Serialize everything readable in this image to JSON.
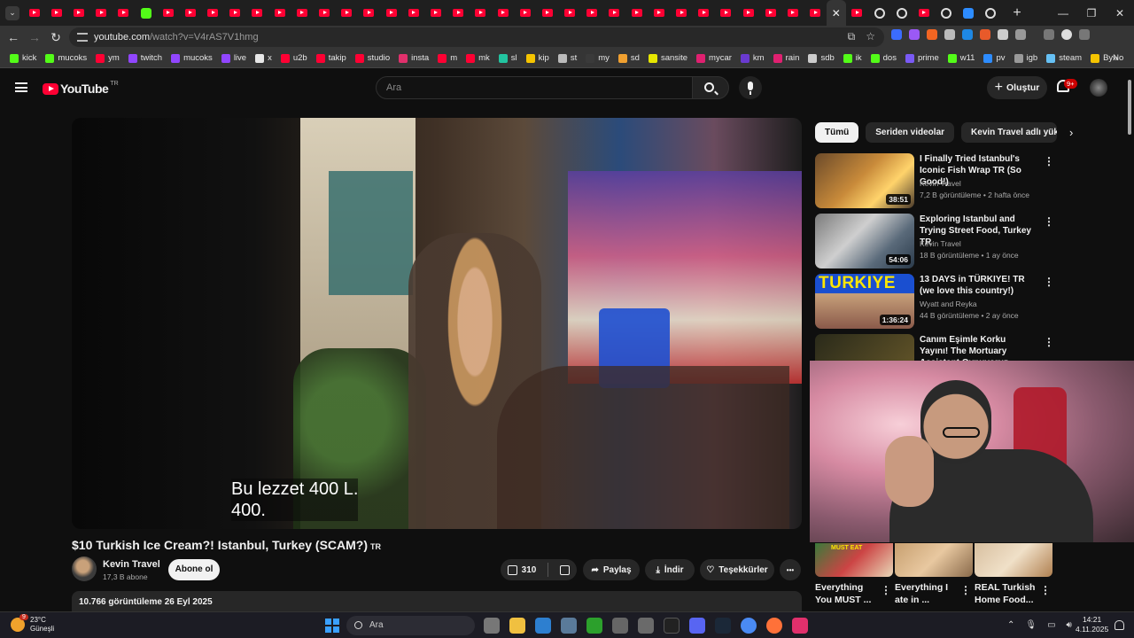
{
  "browser": {
    "url_host": "youtube.com",
    "url_path": "/watch?v=V4rAS7V1hmg",
    "active_tab_close": "✕",
    "new_tab": "+"
  },
  "bookmarks": [
    {
      "label": "kick",
      "color": "#53fc18"
    },
    {
      "label": "mucoks",
      "color": "#53fc18"
    },
    {
      "label": "ym",
      "color": "#ff0033"
    },
    {
      "label": "twitch",
      "color": "#9146ff"
    },
    {
      "label": "mucoks",
      "color": "#9146ff"
    },
    {
      "label": "live",
      "color": "#9146ff"
    },
    {
      "label": "x",
      "color": "#e7e7e7"
    },
    {
      "label": "u2b",
      "color": "#ff0033"
    },
    {
      "label": "takip",
      "color": "#ff0033"
    },
    {
      "label": "studio",
      "color": "#ff0033"
    },
    {
      "label": "insta",
      "color": "#e1306c"
    },
    {
      "label": "m",
      "color": "#ff0033"
    },
    {
      "label": "mk",
      "color": "#ff0033"
    },
    {
      "label": "sl",
      "color": "#22c4a0"
    },
    {
      "label": "kip",
      "color": "#f5c400"
    },
    {
      "label": "st",
      "color": "#bbbbbb"
    },
    {
      "label": "my",
      "color": "#3a3a3a"
    },
    {
      "label": "sd",
      "color": "#f0a030"
    },
    {
      "label": "sansite",
      "color": "#e6e600"
    },
    {
      "label": "mycar",
      "color": "#e02070"
    },
    {
      "label": "km",
      "color": "#6a3ad0"
    },
    {
      "label": "rain",
      "color": "#e02070"
    },
    {
      "label": "sdb",
      "color": "#cccccc"
    },
    {
      "label": "ik",
      "color": "#53fc18"
    },
    {
      "label": "dos",
      "color": "#53fc18"
    },
    {
      "label": "prime",
      "color": "#7a5af5"
    },
    {
      "label": "w11",
      "color": "#53fc18"
    },
    {
      "label": "pv",
      "color": "#2d8cff"
    },
    {
      "label": "igb",
      "color": "#999999"
    },
    {
      "label": "steam",
      "color": "#66c0f4"
    },
    {
      "label": "ByNo",
      "color": "#f5c400"
    }
  ],
  "bookmarks_more": "»",
  "youtube": {
    "logo_text": "YouTube",
    "country_code": "TR",
    "search_placeholder": "Ara",
    "create_label": "Oluştur",
    "notif_badge": "9+"
  },
  "video": {
    "subtitle_line1": "Bu lezzet 400 L.",
    "subtitle_line2": "400.",
    "title": "$10 Turkish Ice Cream?! Istanbul, Turkey (SCAM?)",
    "title_flag": "TR",
    "channel": "Kevin Travel",
    "subscribers": "17,3 B abone",
    "subscribe_label": "Abone ol",
    "likes": "310",
    "share_label": "Paylaş",
    "download_label": "İndir",
    "thanks_label": "Teşekkürler",
    "more": "•••",
    "views_date": "10.766 görüntüleme  26 Eyl 2025"
  },
  "chips": [
    "Tümü",
    "Seriden videolar",
    "Kevin Travel adlı yükleyen"
  ],
  "chips_next": "›",
  "recommendations": [
    {
      "title": "I Finally Tried Istanbul's Iconic Fish Wrap TR (So Good!)",
      "channel": "Kevin Travel",
      "meta": "7,2 B görüntüleme • 2 hafta önce",
      "duration": "38:51"
    },
    {
      "title": "Exploring Istanbul and Trying Street Food, Turkey TR",
      "channel": "Kevin Travel",
      "meta": "18 B görüntüleme • 1 ay önce",
      "duration": "54:06"
    },
    {
      "title": "13 DAYS in TÜRKIYE! TR (we love this country!)",
      "channel": "Wyatt and Reyka",
      "meta": "44 B görüntüleme • 2 ay önce",
      "duration": "1:36:24",
      "overlay": "TURKIYE"
    },
    {
      "title": "Canım Eşimle Korku Yayını! The Mortuary Assistant Oynuyoruz...",
      "channel": "",
      "meta": "",
      "duration": ""
    }
  ],
  "shorts": [
    {
      "title": "Everything You MUST ...",
      "badge": "MUST EAT"
    },
    {
      "title": "Everything I ate in ..."
    },
    {
      "title": "REAL Turkish Home Food..."
    }
  ],
  "kebab": "⋮",
  "taskbar": {
    "temp": "23°C",
    "condition": "Güneşli",
    "weather_badge": "9",
    "search_label": "Ara",
    "time": "14:21",
    "date": "4.11.2025"
  }
}
